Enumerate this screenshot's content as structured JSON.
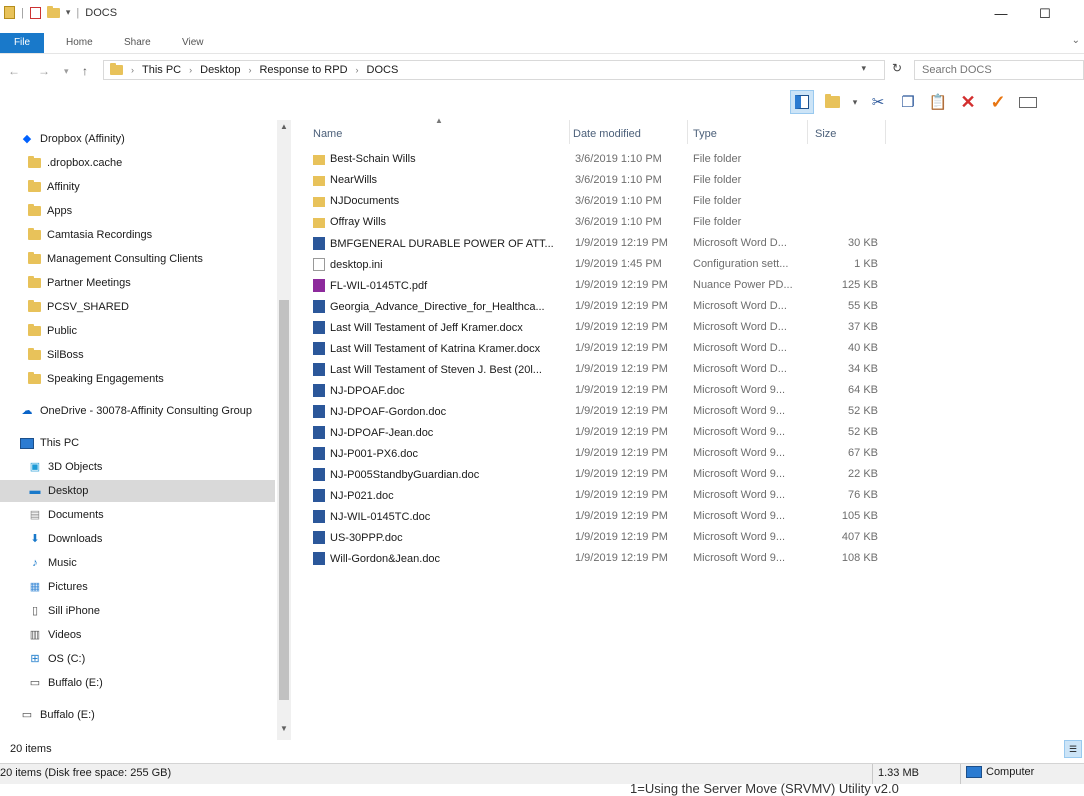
{
  "window": {
    "title": "DOCS",
    "controls": {
      "minimize": "—",
      "maximize": "☐"
    }
  },
  "ribbon": {
    "tabs": [
      "File",
      "Home",
      "Share",
      "View"
    ],
    "expand_glyph": "⌄"
  },
  "address_bar": {
    "breadcrumbs": [
      "This PC",
      "Desktop",
      "Response to RPD",
      "DOCS"
    ],
    "search_placeholder": "Search DOCS"
  },
  "nav_pane": {
    "dropbox": {
      "label": "Dropbox (Affinity)",
      "items": [
        ".dropbox.cache",
        "Affinity",
        "Apps",
        "Camtasia Recordings",
        "Management Consulting Clients",
        "Partner Meetings",
        "PCSV_SHARED",
        "Public",
        "SilBoss",
        "Speaking Engagements"
      ]
    },
    "onedrive": "OneDrive - 30078-Affinity Consulting Group",
    "this_pc": {
      "label": "This PC",
      "items": [
        "3D Objects",
        "Desktop",
        "Documents",
        "Downloads",
        "Music",
        "Pictures",
        "Sill iPhone",
        "Videos",
        "OS (C:)",
        "Buffalo (E:)"
      ]
    },
    "selected": "Desktop",
    "extra": "Buffalo (E:)"
  },
  "file_list": {
    "columns": {
      "name": "Name",
      "date": "Date modified",
      "type": "Type",
      "size": "Size"
    },
    "rows": [
      {
        "icon": "folder",
        "name": "Best-Schain Wills",
        "date": "3/6/2019 1:10 PM",
        "type": "File folder",
        "size": ""
      },
      {
        "icon": "folder",
        "name": "NearWills",
        "date": "3/6/2019 1:10 PM",
        "type": "File folder",
        "size": ""
      },
      {
        "icon": "folder",
        "name": "NJDocuments",
        "date": "3/6/2019 1:10 PM",
        "type": "File folder",
        "size": ""
      },
      {
        "icon": "folder",
        "name": "Offray Wills",
        "date": "3/6/2019 1:10 PM",
        "type": "File folder",
        "size": ""
      },
      {
        "icon": "word",
        "name": "BMFGENERAL DURABLE POWER OF ATT...",
        "date": "1/9/2019 12:19 PM",
        "type": "Microsoft Word D...",
        "size": "30 KB"
      },
      {
        "icon": "ini",
        "name": "desktop.ini",
        "date": "1/9/2019 1:45 PM",
        "type": "Configuration sett...",
        "size": "1 KB"
      },
      {
        "icon": "pdf",
        "name": "FL-WIL-0145TC.pdf",
        "date": "1/9/2019 12:19 PM",
        "type": "Nuance Power PD...",
        "size": "125 KB"
      },
      {
        "icon": "word",
        "name": "Georgia_Advance_Directive_for_Healthca...",
        "date": "1/9/2019 12:19 PM",
        "type": "Microsoft Word D...",
        "size": "55 KB"
      },
      {
        "icon": "word",
        "name": "Last Will Testament of Jeff Kramer.docx",
        "date": "1/9/2019 12:19 PM",
        "type": "Microsoft Word D...",
        "size": "37 KB"
      },
      {
        "icon": "word",
        "name": "Last Will Testament of Katrina Kramer.docx",
        "date": "1/9/2019 12:19 PM",
        "type": "Microsoft Word D...",
        "size": "40 KB"
      },
      {
        "icon": "word",
        "name": "Last Will Testament of Steven J. Best (20l...",
        "date": "1/9/2019 12:19 PM",
        "type": "Microsoft Word D...",
        "size": "34 KB"
      },
      {
        "icon": "word",
        "name": "NJ-DPOAF.doc",
        "date": "1/9/2019 12:19 PM",
        "type": "Microsoft Word 9...",
        "size": "64 KB"
      },
      {
        "icon": "word",
        "name": "NJ-DPOAF-Gordon.doc",
        "date": "1/9/2019 12:19 PM",
        "type": "Microsoft Word 9...",
        "size": "52 KB"
      },
      {
        "icon": "word",
        "name": "NJ-DPOAF-Jean.doc",
        "date": "1/9/2019 12:19 PM",
        "type": "Microsoft Word 9...",
        "size": "52 KB"
      },
      {
        "icon": "word",
        "name": "NJ-P001-PX6.doc",
        "date": "1/9/2019 12:19 PM",
        "type": "Microsoft Word 9...",
        "size": "67 KB"
      },
      {
        "icon": "word",
        "name": "NJ-P005StandbyGuardian.doc",
        "date": "1/9/2019 12:19 PM",
        "type": "Microsoft Word 9...",
        "size": "22 KB"
      },
      {
        "icon": "word",
        "name": "NJ-P021.doc",
        "date": "1/9/2019 12:19 PM",
        "type": "Microsoft Word 9...",
        "size": "76 KB"
      },
      {
        "icon": "word",
        "name": "NJ-WIL-0145TC.doc",
        "date": "1/9/2019 12:19 PM",
        "type": "Microsoft Word 9...",
        "size": "105 KB"
      },
      {
        "icon": "word",
        "name": "US-30PPP.doc",
        "date": "1/9/2019 12:19 PM",
        "type": "Microsoft Word 9...",
        "size": "407 KB"
      },
      {
        "icon": "word",
        "name": "Will-Gordon&Jean.doc",
        "date": "1/9/2019 12:19 PM",
        "type": "Microsoft Word 9...",
        "size": "108 KB"
      }
    ]
  },
  "status_bar": {
    "item_count": "20 items"
  },
  "bottom_status": {
    "left": "20 items (Disk free space: 255 GB)",
    "size": "1.33 MB",
    "location": "Computer"
  },
  "background_text": "1=Using the Server Move (SRVMV) Utility v2.0",
  "colors": {
    "accent": "#1979ca",
    "selection": "#d9d9d9",
    "header_text": "#4c607a",
    "delete_red": "#d83b01",
    "check_orange": "#e87511"
  },
  "icons": [
    "folder-icon",
    "word-doc-icon",
    "ini-file-icon",
    "pdf-icon",
    "dropbox-icon",
    "onedrive-icon",
    "computer-icon",
    "drive-icon",
    "cut-icon",
    "copy-icon",
    "paste-icon",
    "delete-icon",
    "check-icon",
    "rename-icon"
  ]
}
